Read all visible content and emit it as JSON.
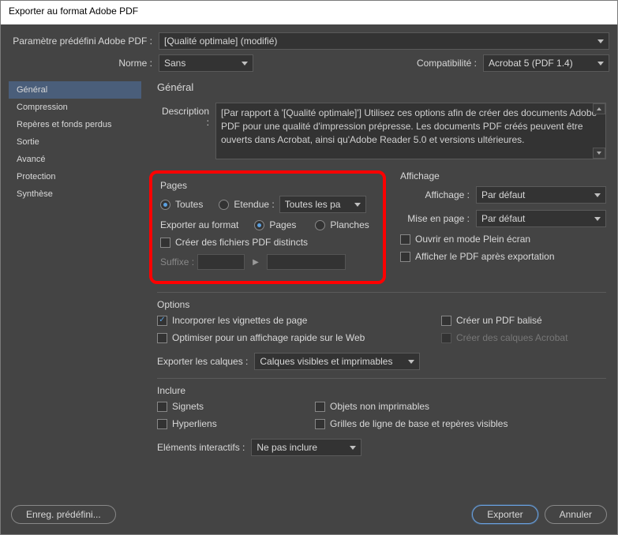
{
  "title": "Exporter au format Adobe PDF",
  "preset": {
    "label": "Paramètre prédéfini Adobe PDF :",
    "value": "[Qualité optimale] (modifié)"
  },
  "standard": {
    "label": "Norme :",
    "value": "Sans"
  },
  "compat": {
    "label": "Compatibilité :",
    "value": "Acrobat 5 (PDF 1.4)"
  },
  "sidebar": {
    "items": [
      "Général",
      "Compression",
      "Repères et fonds perdus",
      "Sortie",
      "Avancé",
      "Protection",
      "Synthèse"
    ]
  },
  "panel": {
    "title": "Général",
    "description_label": "Description :",
    "description_text": "[Par rapport à '[Qualité optimale]'] Utilisez ces options afin de créer des documents Adobe PDF pour une qualité d'impression prépresse. Les documents PDF créés peuvent être ouverts dans Acrobat, ainsi qu'Adobe Reader 5.0 et versions ultérieures."
  },
  "pages": {
    "group_title": "Pages",
    "all": "Toutes",
    "range": "Etendue :",
    "range_value": "Toutes les pa",
    "export_as": "Exporter au format",
    "pages_label": "Pages",
    "spreads_label": "Planches",
    "separate_files": "Créer des fichiers PDF distincts",
    "suffix_label": "Suffixe :"
  },
  "display": {
    "group_title": "Affichage",
    "view_label": "Affichage :",
    "view_value": "Par défaut",
    "layout_label": "Mise en page :",
    "layout_value": "Par défaut",
    "fullscreen": "Ouvrir en mode Plein écran",
    "view_after": "Afficher le PDF après exportation"
  },
  "options": {
    "group_title": "Options",
    "thumbnails": "Incorporer les vignettes de page",
    "tagged": "Créer un PDF balisé",
    "fast_web": "Optimiser pour un affichage rapide sur le Web",
    "acrobat_layers": "Créer des calques Acrobat",
    "export_layers_label": "Exporter les calques :",
    "export_layers_value": "Calques visibles et imprimables"
  },
  "include": {
    "group_title": "Inclure",
    "bookmarks": "Signets",
    "non_printing": "Objets non imprimables",
    "hyperlinks": "Hyperliens",
    "guides": "Grilles de ligne de base et repères visibles",
    "interactive_label": "Eléments interactifs :",
    "interactive_value": "Ne pas inclure"
  },
  "footer": {
    "save_preset": "Enreg. prédéfini...",
    "export": "Exporter",
    "cancel": "Annuler"
  }
}
